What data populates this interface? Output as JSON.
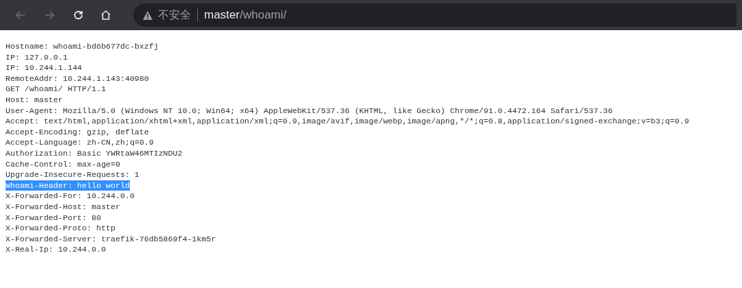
{
  "toolbar": {
    "back": {
      "disabled": true
    },
    "forward": {
      "disabled": true
    },
    "address_bar": {
      "security_label": "不安全",
      "host": "master",
      "path": "/whoami/"
    }
  },
  "lines": [
    {
      "text": "Hostname: whoami-bd6b677dc-bxzfj",
      "selected": false
    },
    {
      "text": "IP: 127.0.0.1",
      "selected": false
    },
    {
      "text": "IP: 10.244.1.144",
      "selected": false
    },
    {
      "text": "RemoteAddr: 10.244.1.143:40980",
      "selected": false
    },
    {
      "text": "GET /whoami/ HTTP/1.1",
      "selected": false
    },
    {
      "text": "Host: master",
      "selected": false
    },
    {
      "text": "User-Agent: Mozilla/5.0 (Windows NT 10.0; Win64; x64) AppleWebKit/537.36 (KHTML, like Gecko) Chrome/91.0.4472.164 Safari/537.36",
      "selected": false
    },
    {
      "text": "Accept: text/html,application/xhtml+xml,application/xml;q=0.9,image/avif,image/webp,image/apng,*/*;q=0.8,application/signed-exchange;v=b3;q=0.9",
      "selected": false
    },
    {
      "text": "Accept-Encoding: gzip, deflate",
      "selected": false
    },
    {
      "text": "Accept-Language: zh-CN,zh;q=0.9",
      "selected": false
    },
    {
      "text": "Authorization: Basic YWRtaW46MTIzNDU2",
      "selected": false
    },
    {
      "text": "Cache-Control: max-age=0",
      "selected": false
    },
    {
      "text": "Upgrade-Insecure-Requests: 1",
      "selected": false
    },
    {
      "text": "Whoami-Header: hello world",
      "selected": true
    },
    {
      "text": "X-Forwarded-For: 10.244.0.0",
      "selected": false
    },
    {
      "text": "X-Forwarded-Host: master",
      "selected": false
    },
    {
      "text": "X-Forwarded-Port: 80",
      "selected": false
    },
    {
      "text": "X-Forwarded-Proto: http",
      "selected": false
    },
    {
      "text": "X-Forwarded-Server: traefik-76db5869f4-1km5r",
      "selected": false
    },
    {
      "text": "X-Real-Ip: 10.244.0.0",
      "selected": false
    }
  ]
}
